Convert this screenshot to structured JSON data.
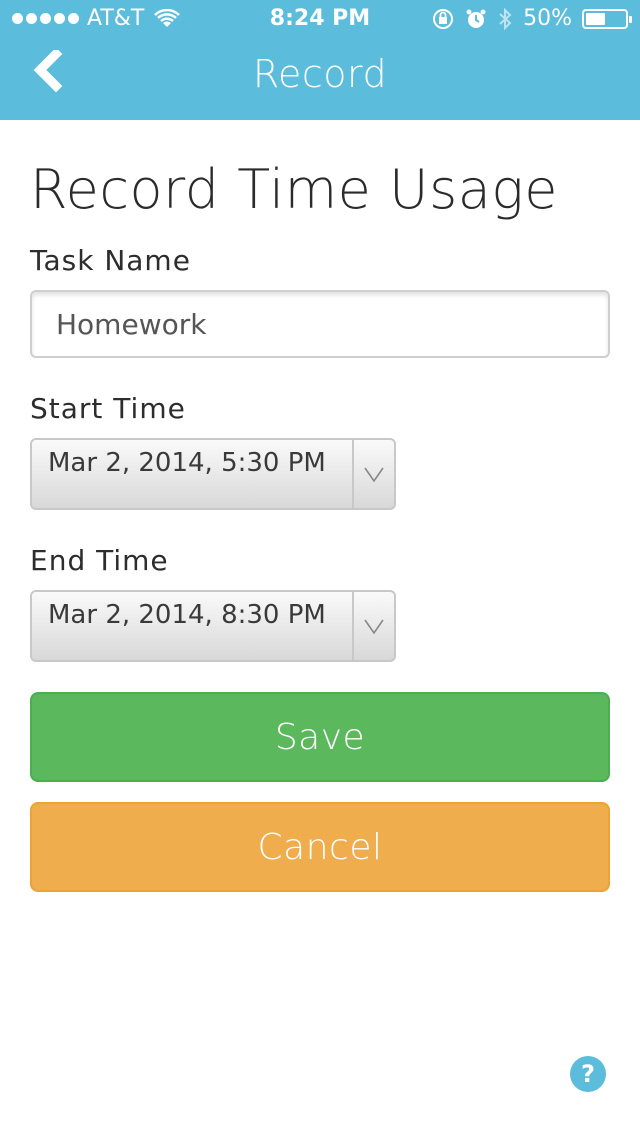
{
  "status_bar": {
    "carrier": "AT&T",
    "time": "8:24 PM",
    "battery_percent": "50%",
    "battery_level": 0.5,
    "icons": [
      "signal-dots-icon",
      "wifi-icon",
      "rotation-lock-icon",
      "alarm-icon",
      "bluetooth-icon",
      "battery-icon"
    ]
  },
  "nav": {
    "title": "Record",
    "back_icon": "chevron-left-icon"
  },
  "page": {
    "title": "Record Time Usage"
  },
  "form": {
    "task_name_label": "Task Name",
    "task_name_value": "Homework",
    "start_time_label": "Start Time",
    "start_time_value": "Mar 2, 2014, 5:30 PM",
    "end_time_label": "End Time",
    "end_time_value": "Mar 2, 2014, 8:30 PM",
    "dropdown_icon": "chevron-down-icon"
  },
  "buttons": {
    "save": "Save",
    "cancel": "Cancel"
  },
  "help": {
    "icon": "question-icon",
    "glyph": "?"
  },
  "colors": {
    "header": "#5bbcdc",
    "save": "#5cb85c",
    "cancel": "#f0ad4e",
    "help": "#5bbcdc"
  }
}
